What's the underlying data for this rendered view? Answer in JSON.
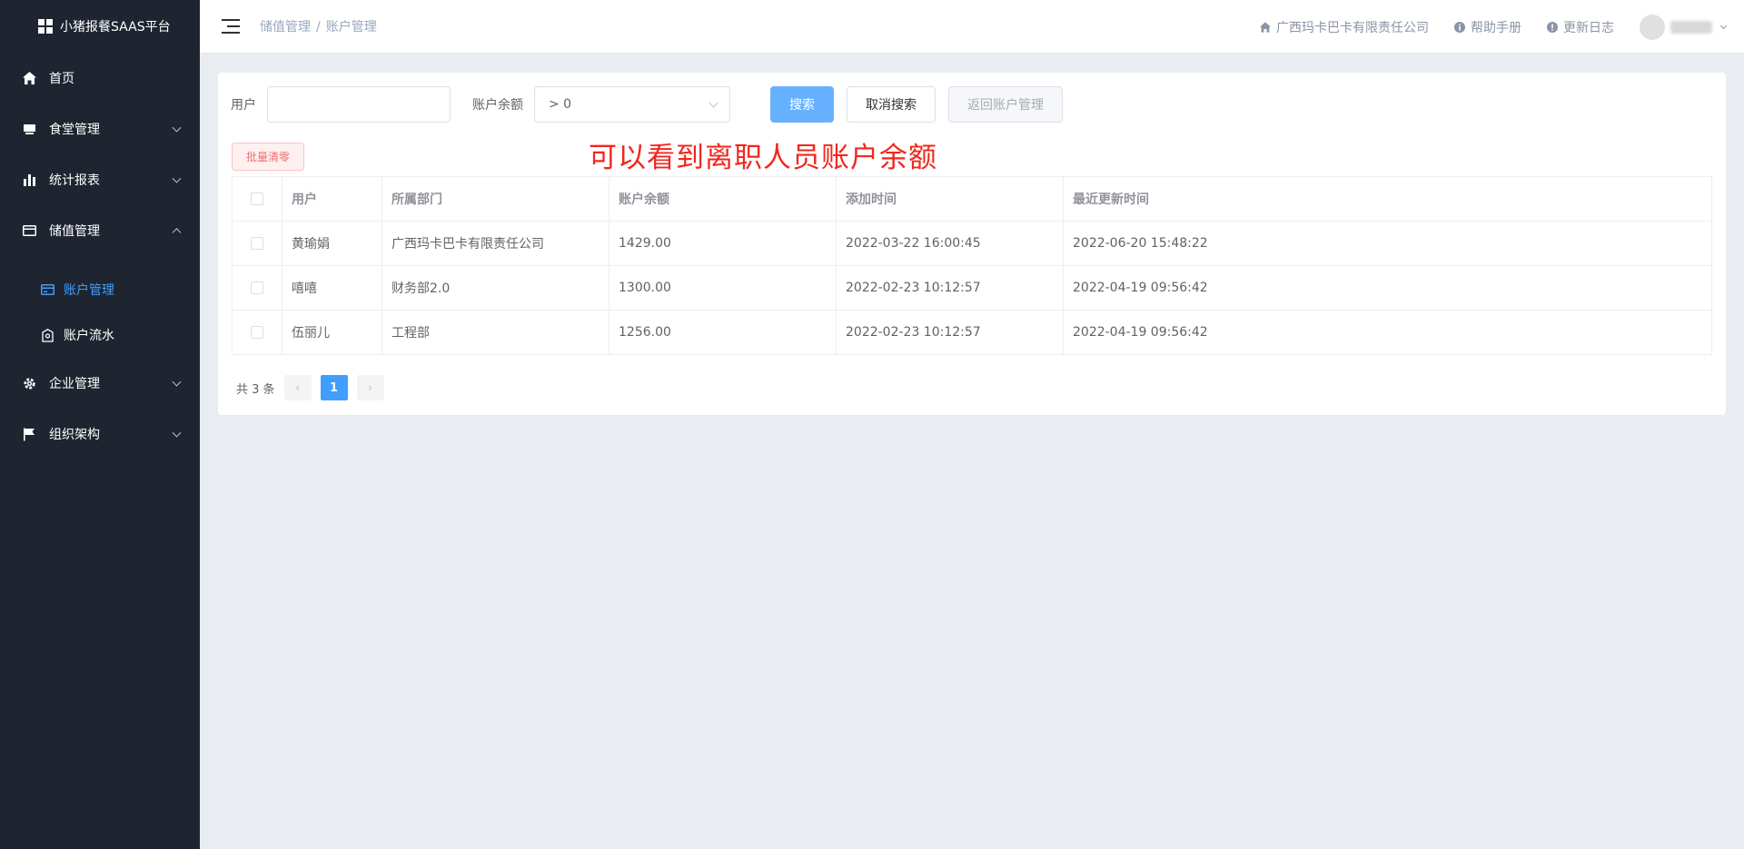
{
  "brand": {
    "name": "小猪报餐SAAS平台"
  },
  "sidebar": {
    "items": [
      {
        "label": "首页",
        "icon": "home-icon",
        "has_children": false
      },
      {
        "label": "食堂管理",
        "icon": "canteen-icon",
        "has_children": true,
        "expanded": false
      },
      {
        "label": "统计报表",
        "icon": "bar-chart-icon",
        "has_children": true,
        "expanded": false
      },
      {
        "label": "储值管理",
        "icon": "card-icon",
        "has_children": true,
        "expanded": true,
        "children": [
          {
            "label": "账户管理",
            "icon": "credit-card-icon",
            "active": true
          },
          {
            "label": "账户流水",
            "icon": "wallet-icon",
            "active": false
          }
        ]
      },
      {
        "label": "企业管理",
        "icon": "gear-icon",
        "has_children": true,
        "expanded": false
      },
      {
        "label": "组织架构",
        "icon": "flag-icon",
        "has_children": true,
        "expanded": false
      }
    ]
  },
  "header": {
    "breadcrumb": [
      "储值管理",
      "账户管理"
    ],
    "breadcrumb_sep": "/",
    "company": "广西玛卡巴卡有限责任公司",
    "help": "帮助手册",
    "changelog": "更新日志"
  },
  "filters": {
    "user_label": "用户",
    "user_value": "",
    "balance_label": "账户余额",
    "balance_value": "> 0",
    "search_button": "搜索",
    "cancel_button": "取消搜索",
    "back_button": "返回账户管理"
  },
  "batch_clear_button": "批量清零",
  "annotation": "可以看到离职人员账户余额",
  "table": {
    "columns": [
      "用户",
      "所属部门",
      "账户余额",
      "添加时间",
      "最近更新时间"
    ],
    "rows": [
      [
        "黄瑜娟",
        "广西玛卡巴卡有限责任公司",
        "1429.00",
        "2022-03-22 16:00:45",
        "2022-06-20 15:48:22"
      ],
      [
        "嘻嘻",
        "财务部2.0",
        "1300.00",
        "2022-02-23 10:12:57",
        "2022-04-19 09:56:42"
      ],
      [
        "伍丽儿",
        "工程部",
        "1256.00",
        "2022-02-23 10:12:57",
        "2022-04-19 09:56:42"
      ]
    ]
  },
  "pagination": {
    "total_text": "共 3 条",
    "prev": "‹",
    "current": "1",
    "next": "›"
  },
  "colors": {
    "sidebar_bg": "#1f2530",
    "accent": "#409eff",
    "annotation": "#f2261d"
  }
}
